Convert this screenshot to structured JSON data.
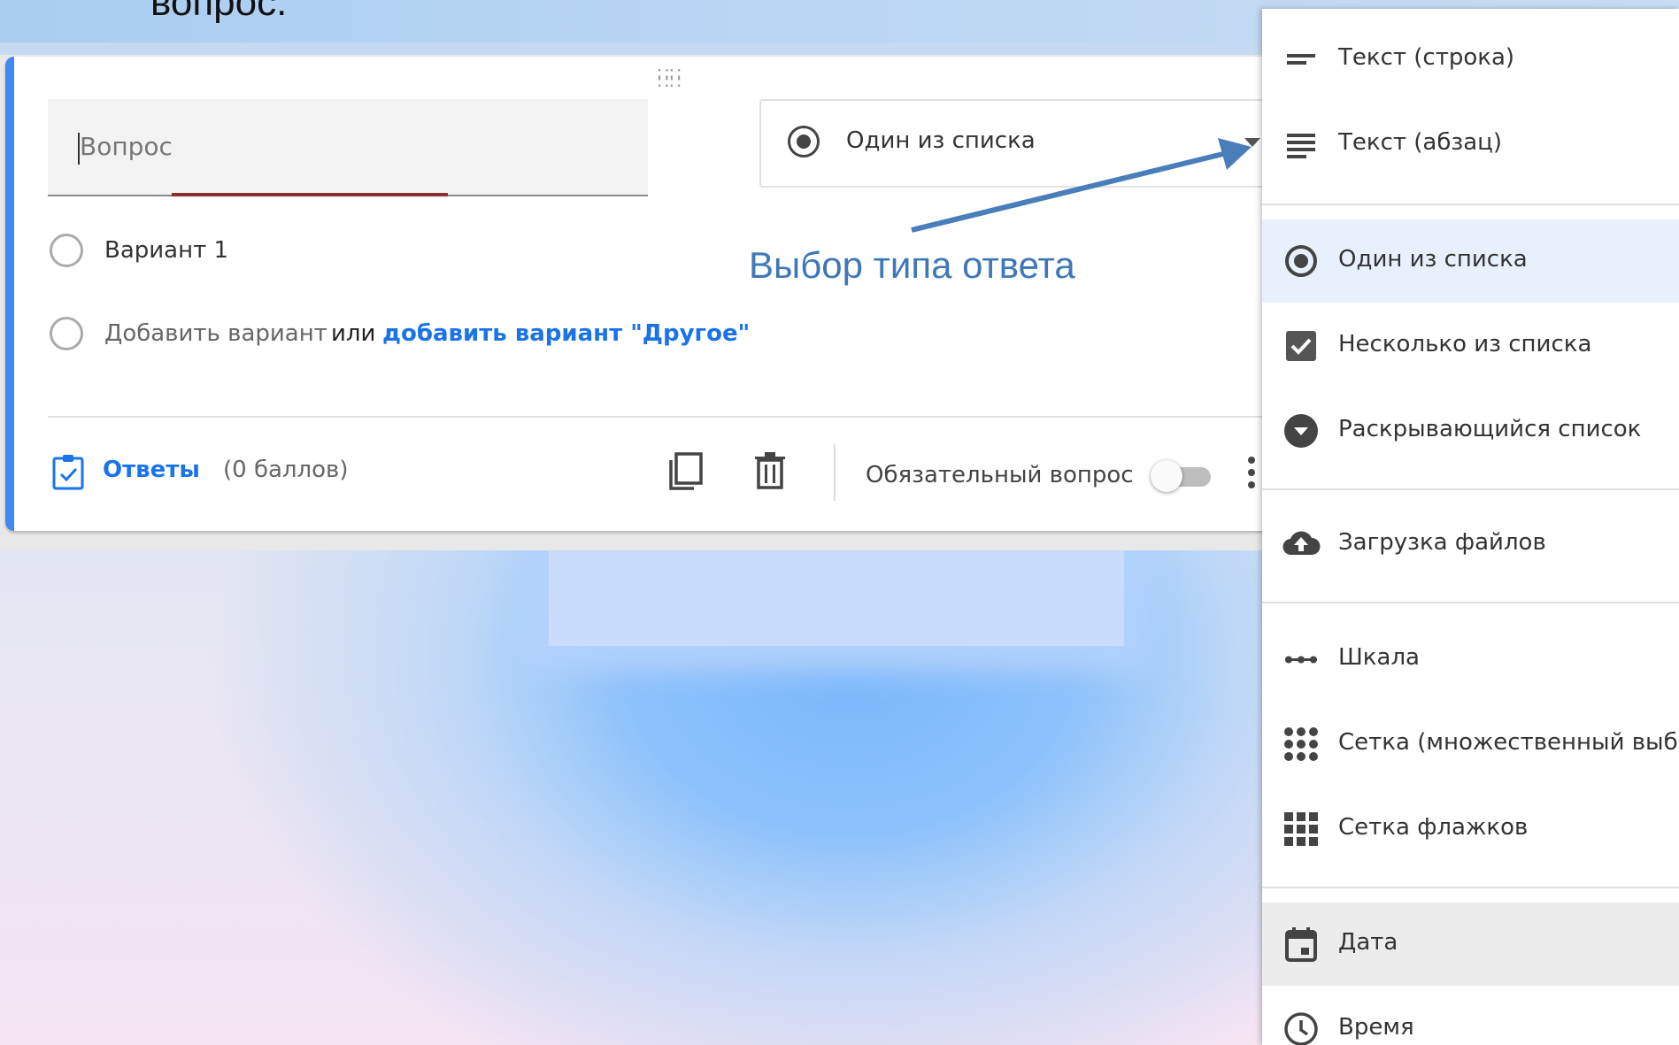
{
  "heading_fragment": "вопрос.",
  "question": {
    "placeholder": "Вопрос"
  },
  "type_select": {
    "value": "Один из списка"
  },
  "options": [
    {
      "label": "Вариант 1"
    }
  ],
  "add_option": {
    "add_label": "Добавить вариант",
    "or_label": "или",
    "add_other_label": "добавить вариант \"Другое\""
  },
  "annotation": {
    "text": "Выбор типа ответа"
  },
  "footer": {
    "answers_label": "Ответы",
    "points_label": "(0 баллов)",
    "required_label": "Обязательный вопрос",
    "required_on": false
  },
  "type_menu": {
    "items": [
      {
        "label": "Текст (строка)",
        "icon": "short-text-icon"
      },
      {
        "label": "Текст (абзац)",
        "icon": "paragraph-icon"
      },
      {
        "label": "Один из списка",
        "icon": "radio-button-icon",
        "selected": true
      },
      {
        "label": "Несколько из списка",
        "icon": "checkbox-icon"
      },
      {
        "label": "Раскрывающийся список",
        "icon": "dropdown-icon"
      },
      {
        "label": "Загрузка файлов",
        "icon": "cloud-upload-icon"
      },
      {
        "label": "Шкала",
        "icon": "linear-scale-icon"
      },
      {
        "label": "Сетка (множественный выбор)",
        "icon": "grid-dots-icon"
      },
      {
        "label": "Сетка флажков",
        "icon": "grid-squares-icon"
      },
      {
        "label": "Дата",
        "icon": "calendar-icon",
        "hovered": true
      },
      {
        "label": "Время",
        "icon": "clock-icon"
      }
    ]
  },
  "colors": {
    "accent": "#4285f4",
    "link": "#1a73e8",
    "annotation": "#3f78b8",
    "selected_bg": "#e8f0fe"
  }
}
